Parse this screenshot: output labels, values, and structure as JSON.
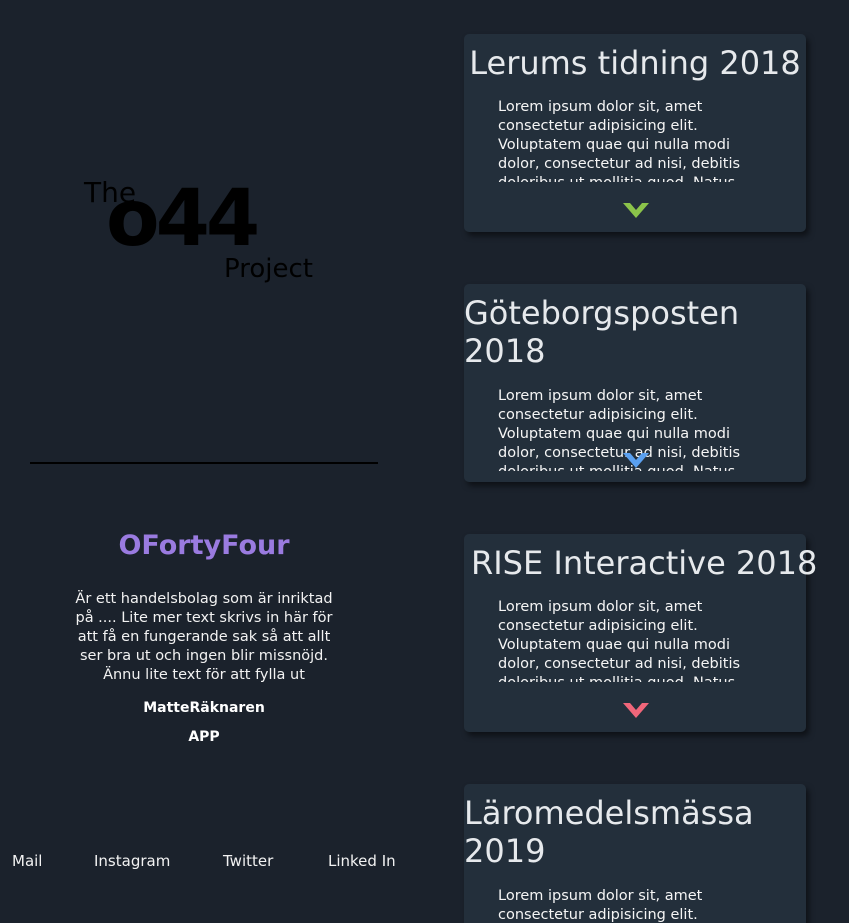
{
  "logo": {
    "the": "The",
    "number": "o44",
    "project": "Project"
  },
  "brand": {
    "name": "OFortyFour",
    "description": "Är ett handelsbolag som är inriktad på .... Lite mer text skrivs in här för att få en fungerande sak så att allt ser bra ut och ingen blir missnöjd. Ännu lite text för att fylla ut",
    "link_1": "MatteRäknaren",
    "link_2": "APP"
  },
  "footer_nav": [
    "Mail",
    "Instagram",
    "Twitter",
    "Linked In"
  ],
  "lorem": "Lorem ipsum dolor sit, amet consectetur adipisicing elit. Voluptatem quae qui nulla modi dolor, consectetur ad nisi, debitis doloribus ut mollitia quod. Natus",
  "cards": [
    {
      "title": "Lerums tidning 2018",
      "chevron_color": "#8bc34a",
      "chevron_icon": "chevron-down-icon"
    },
    {
      "title": "Göteborgsposten 2018",
      "chevron_color": "#5aa0f0",
      "chevron_icon": "chevron-down-icon"
    },
    {
      "title": "RISE Interactive 2018",
      "chevron_color": "#f0667a",
      "chevron_icon": "chevron-down-icon"
    },
    {
      "title": "Läromedelsmässa 2019",
      "chevron_color": "",
      "chevron_icon": ""
    }
  ],
  "colors": {
    "background": "#1b222c",
    "card": "#232f3b",
    "brand": "#9a7be0"
  }
}
